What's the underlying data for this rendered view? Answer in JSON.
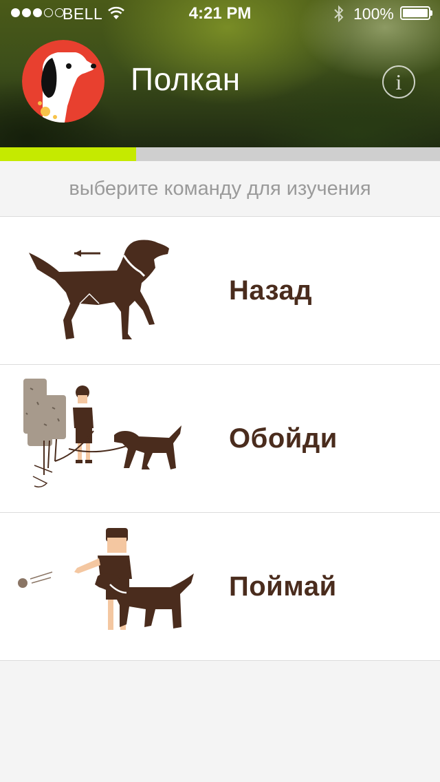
{
  "status_bar": {
    "carrier": "BELL",
    "time": "4:21 PM",
    "battery": "100%",
    "signal_bars_filled": 3,
    "signal_bars_total": 5
  },
  "header": {
    "pet_name": "Полкан",
    "info_label": "i",
    "progress": 0.31
  },
  "subtitle": "выберите команду для изучения",
  "commands": [
    {
      "label": "Назад",
      "icon": "dog-walking-back-icon"
    },
    {
      "label": "Обойди",
      "icon": "man-dog-tree-icon"
    },
    {
      "label": "Поймай",
      "icon": "man-dog-ball-icon"
    }
  ],
  "colors": {
    "accent_progress": "#c5ea00",
    "label_brown": "#4a2c1d",
    "avatar_red": "#e8402f",
    "subtitle_gray": "#9a9a9a"
  }
}
